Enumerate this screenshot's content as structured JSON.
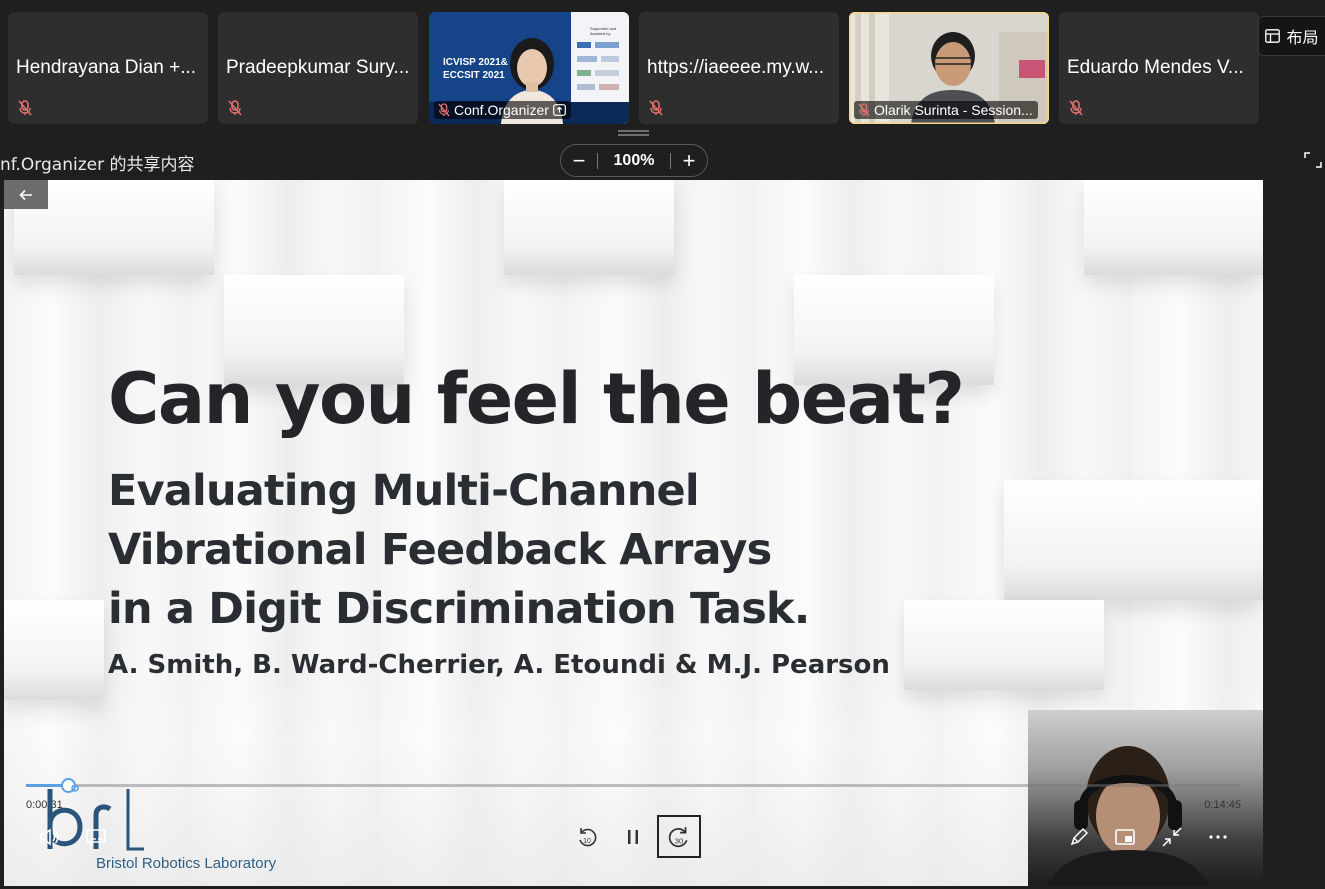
{
  "participants": [
    {
      "name": "Hendrayana Dian +...",
      "muted": true,
      "video": false
    },
    {
      "name": "Pradeepkumar Sury...",
      "muted": true,
      "video": false
    },
    {
      "name": "Conf.Organizer",
      "muted": true,
      "video": true,
      "sharing": true,
      "thumb_text": {
        "line1": "ICVISP 2021&",
        "line2": "ECCSIT 2021",
        "sponsor_note": "Supported and Assisted by"
      }
    },
    {
      "name": "https://iaeeee.my.w...",
      "muted": true,
      "video": false
    },
    {
      "name": "Olarik Surinta - Session...",
      "muted": true,
      "video": true
    },
    {
      "name": "Eduardo Mendes V...",
      "muted": true,
      "video": false
    }
  ],
  "layout_button": {
    "label": "布局",
    "icon": "layout-icon"
  },
  "share": {
    "label": "nf.Organizer 的共享内容"
  },
  "zoom": {
    "minus": "−",
    "value": "100%",
    "plus": "+"
  },
  "slide": {
    "title": "Can you feel the beat?",
    "subtitle_lines": [
      "Evaluating Multi-Channel",
      "Vibrational Feedback Arrays",
      "in a Digit Discrimination Task."
    ],
    "authors": "A. Smith, B. Ward-Cherrier, A. Etoundi & M.J. Pearson",
    "logo_text": "brl",
    "lab_name": "Bristol Robotics Laboratory"
  },
  "player": {
    "current_time": "0:00:31",
    "total_time": "0:14:45",
    "progress_fraction": 0.035,
    "rewind_label": "10",
    "forward_label": "30",
    "colors": {
      "accent": "#5aa0e0"
    }
  }
}
